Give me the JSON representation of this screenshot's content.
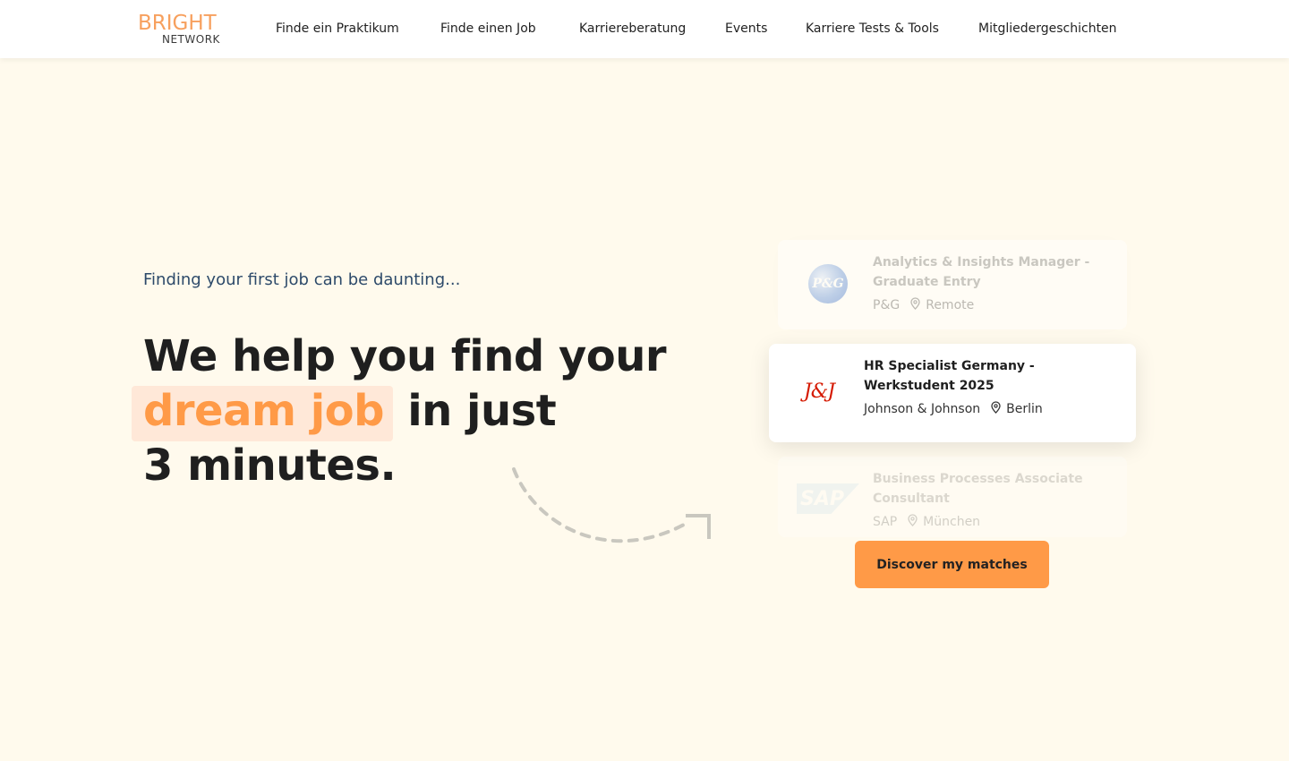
{
  "header": {
    "logo_top": "BRIGHT",
    "logo_bottom": "NETWORK",
    "nav": [
      {
        "label": "Finde ein Praktikum"
      },
      {
        "label": "Finde einen Job"
      },
      {
        "label": "Karriereberatung"
      },
      {
        "label": "Events"
      },
      {
        "label": "Karriere Tests & Tools"
      },
      {
        "label": "Mitgliedergeschichten"
      }
    ]
  },
  "hero": {
    "tagline": "Finding your first job can be daunting...",
    "headline_line1": "We help you find your",
    "headline_highlight": "dream job",
    "headline_line2_rest": " in just",
    "headline_line3": "3 minutes."
  },
  "cards": [
    {
      "title": "Analytics & Insights Manager - Graduate Entry",
      "company": "P&G",
      "location": "Remote",
      "logo_text": "P&G"
    },
    {
      "title": "HR Specialist Germany - Werkstudent 2025",
      "company": "Johnson & Johnson",
      "location": "Berlin",
      "logo_text": "J&J"
    },
    {
      "title": "Business Processes Associate Consultant",
      "company": "SAP",
      "location": "München",
      "logo_text": "SAP"
    }
  ],
  "cta": {
    "label": "Discover my matches"
  },
  "colors": {
    "background": "#fffaed",
    "accent": "#ff9a47",
    "highlight_bg": "#ffe8d8",
    "tagline": "#2d4a6a",
    "jj_red": "#d51900"
  }
}
